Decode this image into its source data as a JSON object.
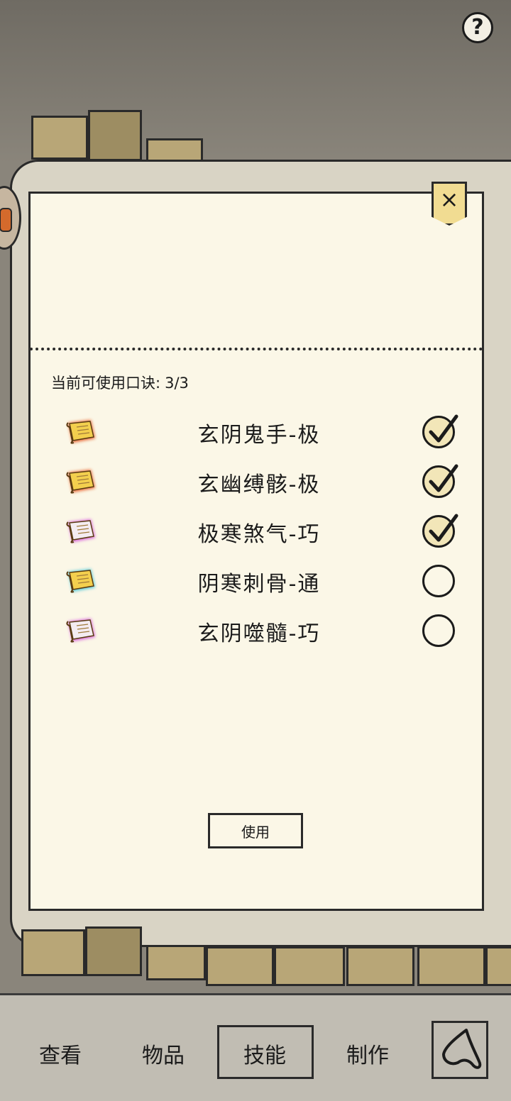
{
  "help": {
    "label": "?"
  },
  "panel": {
    "close_label": "×",
    "counter_label": "当前可使用口诀:",
    "counter_value": "3/3",
    "use_button": "使用"
  },
  "skills": [
    {
      "name": "玄阴鬼手-极",
      "checked": true,
      "icon": "scroll-gold-icon",
      "glow": "#e5531f"
    },
    {
      "name": "玄幽缚骸-极",
      "checked": true,
      "icon": "scroll-gold-icon",
      "glow": "#e5531f"
    },
    {
      "name": "极寒煞气-巧",
      "checked": true,
      "icon": "scroll-white-icon",
      "glow": "#d24fd8"
    },
    {
      "name": "阴寒刺骨-通",
      "checked": false,
      "icon": "scroll-gold-icon",
      "glow": "#3fc3d6"
    },
    {
      "name": "玄阴噬髓-巧",
      "checked": false,
      "icon": "scroll-white-icon",
      "glow": "#d24fd8"
    }
  ],
  "nav": {
    "items": [
      {
        "label": "查看"
      },
      {
        "label": "物品"
      },
      {
        "label": "技能",
        "active": true
      },
      {
        "label": "制作"
      }
    ],
    "back_icon": "back-arrow-icon"
  }
}
